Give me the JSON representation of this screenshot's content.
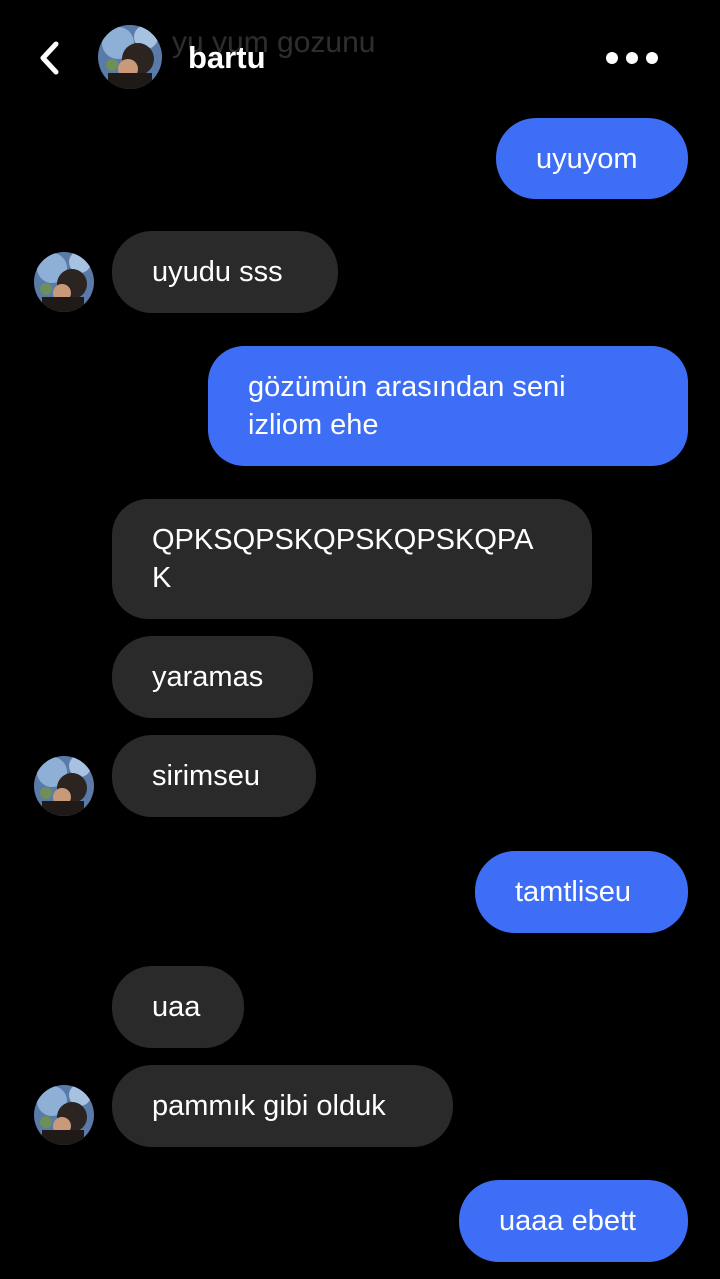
{
  "header": {
    "contact_name": "bartu",
    "ghost_text": "yu yum gozunu",
    "back_icon": "chevron-left-icon",
    "more_icon": "more-horizontal-icon"
  },
  "colors": {
    "background": "#000000",
    "outgoing_bubble": "#3d6ef5",
    "incoming_bubble": "#2a2a2a",
    "text": "#ffffff"
  },
  "messages": [
    {
      "direction": "out",
      "text": "uyuyom"
    },
    {
      "direction": "in",
      "text": "uyudu sss",
      "avatar": true
    },
    {
      "direction": "out",
      "text": "gözümün arasından seni\nizliom ehe"
    },
    {
      "direction": "in",
      "text": "QPKSQPSKQPSKQPSKQPA\nK",
      "avatar": false
    },
    {
      "direction": "in",
      "text": "yaramas",
      "avatar": false
    },
    {
      "direction": "in",
      "text": "sirimseu",
      "avatar": true
    },
    {
      "direction": "out",
      "text": "tamtliseu"
    },
    {
      "direction": "in",
      "text": "uaa",
      "avatar": false
    },
    {
      "direction": "in",
      "text": "pammık gibi olduk",
      "avatar": true
    },
    {
      "direction": "out",
      "text": "uaaa ebett"
    }
  ]
}
